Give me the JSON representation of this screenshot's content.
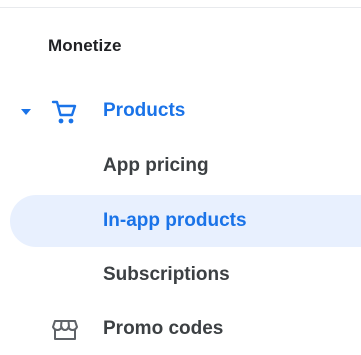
{
  "nav": {
    "section_heading": "Monetize",
    "items": [
      {
        "label": "Products",
        "icon": "shopping-cart-icon",
        "expanded": true,
        "active_parent": true
      },
      {
        "label": "App pricing",
        "child": true
      },
      {
        "label": "In-app products",
        "child": true,
        "selected": true
      },
      {
        "label": "Subscriptions",
        "child": true
      },
      {
        "label": "Promo codes",
        "icon": "storefront-icon"
      }
    ]
  },
  "colors": {
    "accent": "#1a73e8",
    "selected_background": "#e8f0fe",
    "text_primary": "#202124",
    "text_secondary": "#3c4043",
    "icon_gray": "#5f6368",
    "divider": "#e8eaed"
  }
}
